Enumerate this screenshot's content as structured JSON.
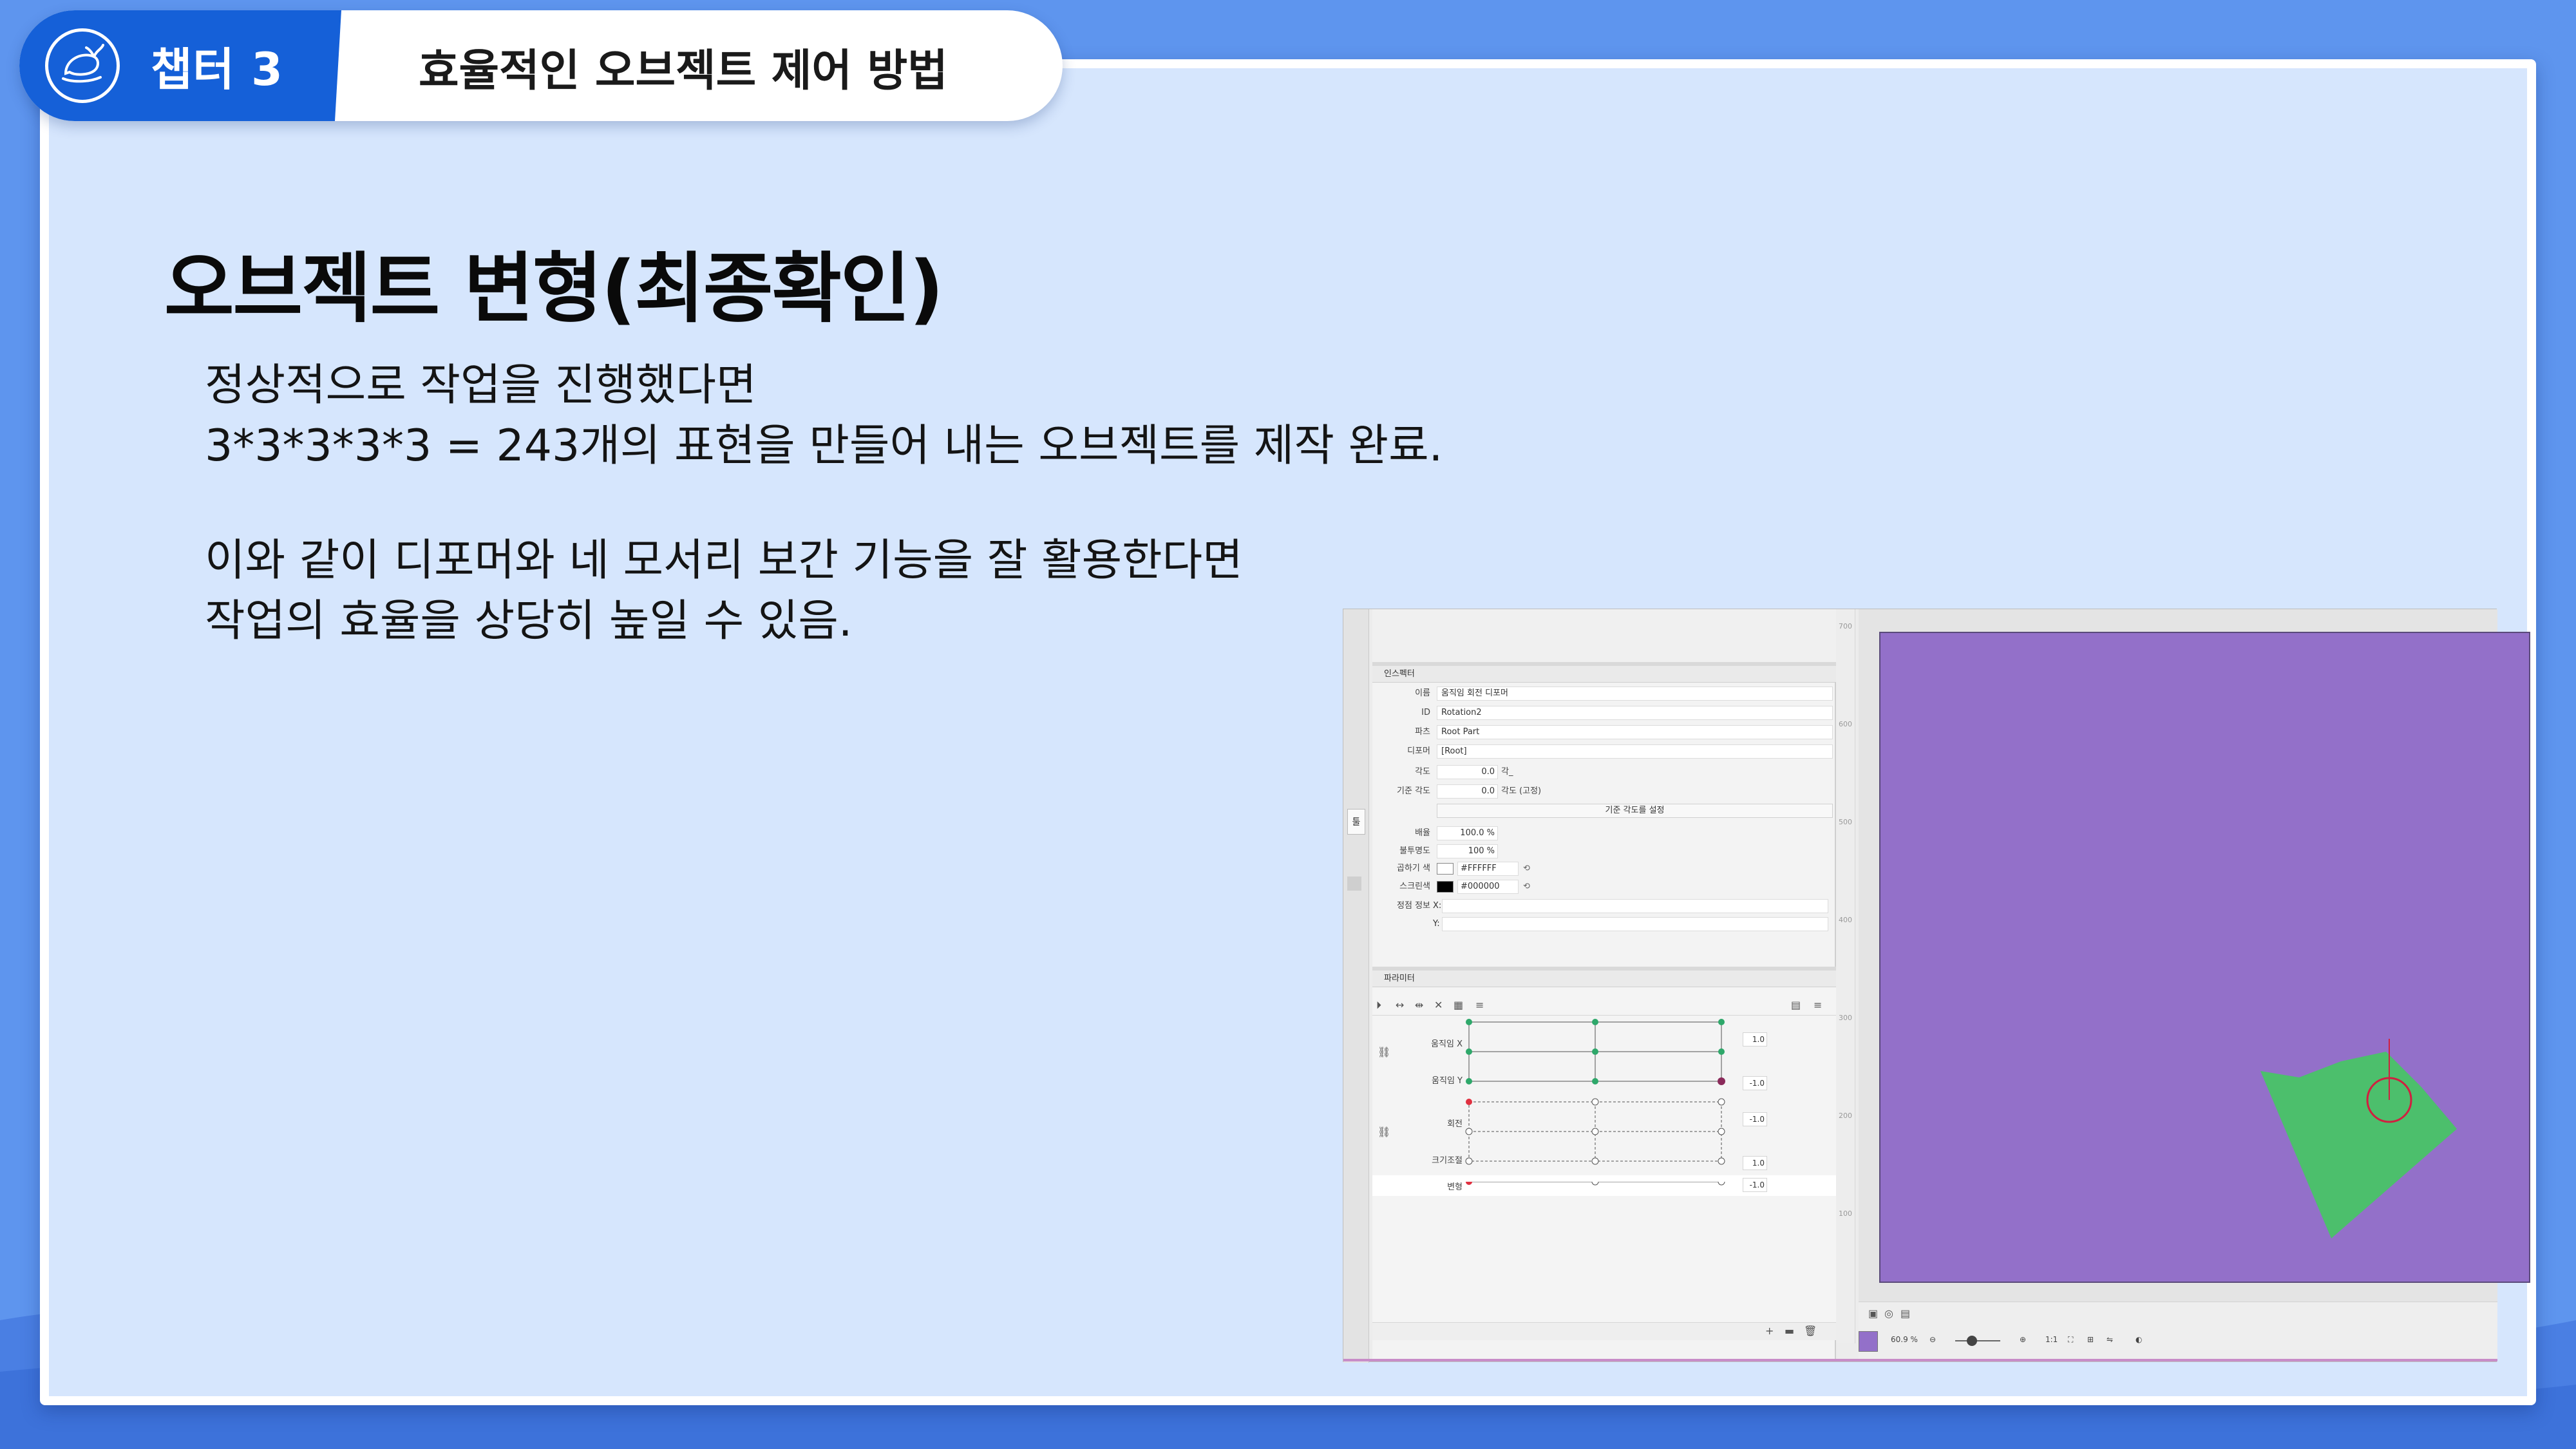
{
  "header": {
    "chapter_label": "챕터 3",
    "chapter_title": "효율적인 오브젝트 제어 방법"
  },
  "slide": {
    "heading": "오브젝트 변형(최종확인)",
    "paragraph1": [
      "정상적으로 작업을 진행했다면",
      "3*3*3*3*3 = 243개의 표현을 만들어 내는 오브젝트를 제작 완료."
    ],
    "paragraph2": [
      "이와 같이 디포머와 네 모서리 보간 기능을 잘 활용한다면",
      "작업의 효율을 상당히 높일 수 있음."
    ]
  },
  "editor": {
    "left_tab": "툴",
    "inspector": {
      "title": "인스펙터",
      "rows": {
        "name": {
          "label": "이름",
          "value": "움직임 회전 디포머"
        },
        "id": {
          "label": "ID",
          "value": "Rotation2"
        },
        "part": {
          "label": "파츠",
          "value": "Root Part"
        },
        "deformer": {
          "label": "디포머",
          "value": "[Root]"
        },
        "angle": {
          "label": "각도",
          "value": "0.0",
          "unit": "각_"
        },
        "base_angle": {
          "label": "기준 각도",
          "value": "0.0",
          "unit": "각도 (고정)"
        },
        "set_base_button": "기준 각도를 설정",
        "scale": {
          "label": "배율",
          "value": "100.0 %"
        },
        "opacity": {
          "label": "불투명도",
          "value": "100 %"
        },
        "multiply_color": {
          "label": "곱하기 색",
          "value": "#FFFFFF",
          "color": "#ffffff"
        },
        "screen_color": {
          "label": "스크린색",
          "value": "#000000",
          "color": "#000000"
        },
        "vertex_info": {
          "label": "정점 정보",
          "x_label": "X:",
          "y_label": "Y:"
        }
      }
    },
    "parameters": {
      "title": "파라미터",
      "rows": [
        {
          "label": "움직임 X",
          "value": "1.0"
        },
        {
          "label": "움직임 Y",
          "value": "-1.0"
        },
        {
          "label": "회전",
          "value": "-1.0"
        },
        {
          "label": "크기조절",
          "value": "1.0"
        },
        {
          "label": "변형",
          "value": "-1.0"
        }
      ]
    },
    "ruler_ticks": [
      "700",
      "600",
      "500",
      "400",
      "300",
      "200",
      "100"
    ],
    "canvas": {
      "background_color": "#9370c9",
      "shape_color": "#4cbf6c"
    },
    "viewbar": {
      "zoom": "60.9 %",
      "ratio": "1:1",
      "swatch_color": "#9370c9"
    }
  }
}
